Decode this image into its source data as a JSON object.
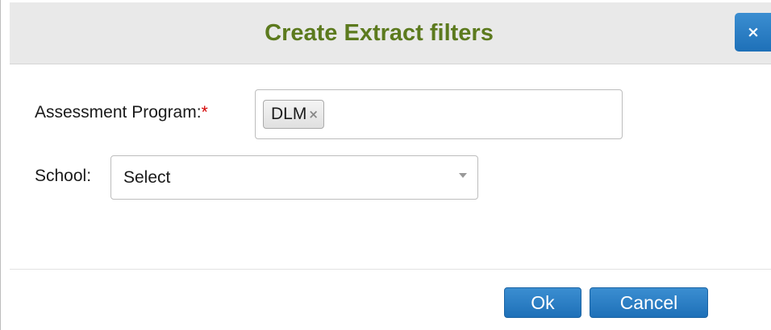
{
  "dialog": {
    "title": "Create Extract filters",
    "close_icon": "close-icon",
    "close_glyph": "×"
  },
  "form": {
    "assessment_program": {
      "label": "Assessment Program:",
      "required_marker": "*",
      "selected_tags": [
        {
          "label": "DLM",
          "remove_glyph": "×"
        }
      ]
    },
    "school": {
      "label": "School:",
      "value": "Select",
      "icon": "chevron-down-icon"
    }
  },
  "footer": {
    "ok_label": "Ok",
    "cancel_label": "Cancel"
  },
  "colors": {
    "title": "#5c7a1e",
    "primary_button": "#2a7fc6",
    "required": "#d40000"
  }
}
